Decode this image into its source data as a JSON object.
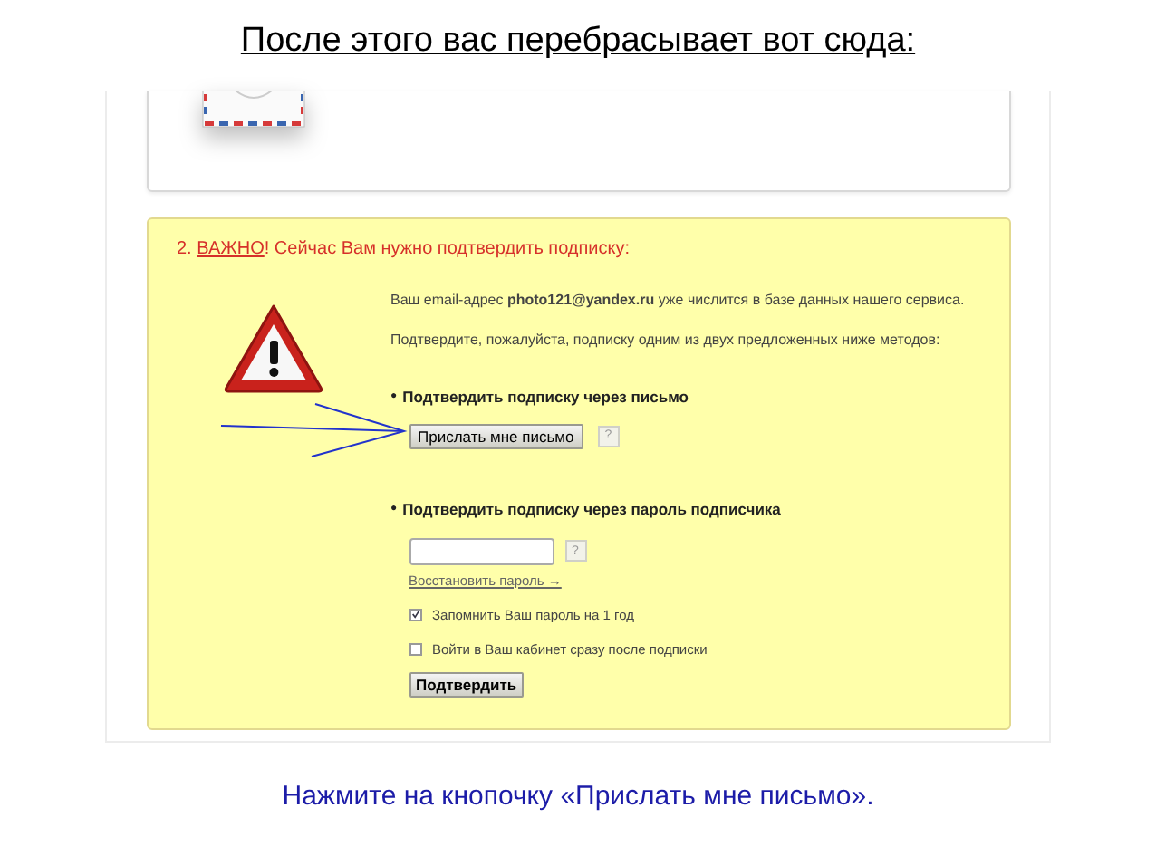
{
  "slide_title": "После этого вас перебрасывает вот сюда:",
  "notice": {
    "heading_prefix": "2. ",
    "heading_link": "ВАЖНО",
    "heading_suffix": "! Сейчас Вам нужно подтвердить подписку:",
    "intro": [
      "Ваш email-адрес **photo121@yandex.ru** уже числится в базе данных нашего сервиса.",
      "Подтвердите, пожалуйста, подписку одним из двух предложенных ниже методов:"
    ],
    "letter_method": {
      "bullet": "●",
      "title": "Подтвердить подписку через письмо",
      "button": "Прислать мне письмо",
      "help": "?"
    },
    "password_method": {
      "bullet": "●",
      "title": "Подтвердить подписку через пароль подписчика",
      "help": "?",
      "link": "Восстановить пароль →",
      "options": [
        {
          "label": "Запомнить Ваш пароль на 1 год",
          "checked": true
        },
        {
          "label": "Войти в Ваш кабинет сразу после подписки",
          "checked": false
        }
      ],
      "button": "Подтвердить"
    }
  },
  "caption": "Нажмите на кнопочку «Прислать мне письмо»."
}
